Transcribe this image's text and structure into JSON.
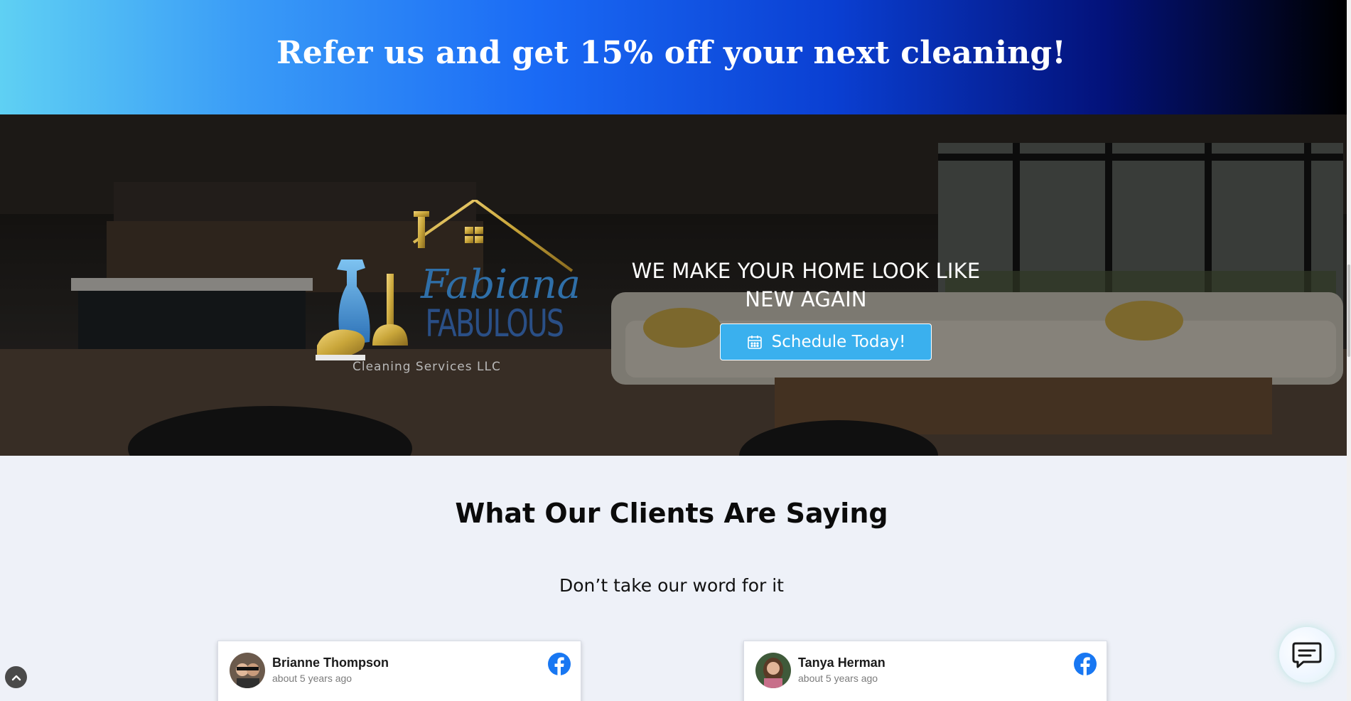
{
  "promo": {
    "headline": "Refer us and get 15% off your next cleaning!"
  },
  "hero": {
    "tagline": "WE MAKE YOUR HOME LOOK LIKE NEW AGAIN",
    "cta_label": "Schedule Today!",
    "logo": {
      "line1": "Fabiana",
      "line2": "FABULOUS",
      "line3": "Cleaning Services LLC"
    }
  },
  "reviews": {
    "title": "What Our Clients Are Saying",
    "subtitle": "Don’t take our word for it",
    "items": [
      {
        "name": "Brianne Thompson",
        "time": "about 5 years ago",
        "source_icon": "facebook-icon"
      },
      {
        "name": "Tanya Herman",
        "time": "about 5 years ago",
        "source_icon": "facebook-icon"
      }
    ]
  },
  "colors": {
    "accent": "#3ab0ee",
    "facebook": "#1877f2",
    "gold": "#c9a63a",
    "logo_blue": "#2f6fa8"
  },
  "icons": {
    "back_to_top": "chevron-up-icon",
    "chat": "chat-icon",
    "calendar": "calendar-icon"
  }
}
